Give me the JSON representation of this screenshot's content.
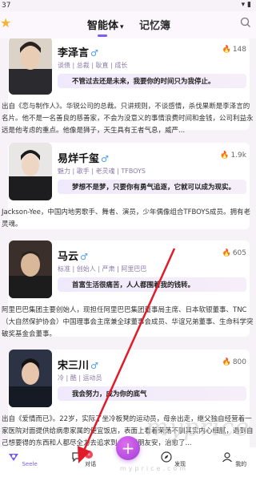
{
  "status_bar": {
    "time": "37",
    "icons": "▾ ▮"
  },
  "top_tabs": [
    {
      "label": "智能体",
      "active": true
    },
    {
      "label": "记忆簿",
      "active": false
    }
  ],
  "cards": [
    {
      "name": "李泽言",
      "gender_symbol": "♂",
      "heat": "148",
      "tags": "谈债 | 总裁 | 耿直 | 成长",
      "quote": "不管过去还是未来，我要你的时间只为我停止。",
      "description": "出自《恋与制作人》。华锐公司的总裁。只讲规则，不谈感情，杀伐果断是李泽言的名片。他不是一名善良的慈善家，不会为没意义的事情浪费时间和金钱，公司利益永远是他考虑的重点。他像是狮子，天生具有王者气息，威严..."
    },
    {
      "name": "易烊千玺",
      "gender_symbol": "♂",
      "heat": "1.9k",
      "tags": "魅力 | 歌手 | 老灵魂 | TFBOYS",
      "quote": "梦想不是梦，只要你有勇气追逐，它就可以成为现实。",
      "description": "Jackson-Yee，中国内地男歌手、舞者、演员，少年偶像组合TFBOYS成员。拥有老灵魂。"
    },
    {
      "name": "马云",
      "gender_symbol": "♂",
      "heat": "605",
      "tags": "标准 | 创始人 | 严肃 | 阿里巴巴",
      "quote": "首富生活很痛苦，人人都围着我的钱转。",
      "description": "阿里巴巴集团主要创始人，现担任阿里巴巴集团董事局主席、日本软银董事、TNC（大自然保护协会）中国理事会主席兼全球董事会成员、华谊兄弟董事、生命科学突破奖基金会董事。"
    },
    {
      "name": "宋三川",
      "gender_symbol": "♂",
      "heat": "800",
      "tags": "冷 | 酷 | 运动员",
      "quote": "我会努力，成为你的底气",
      "description": "出自《爱情而已》。22岁，实际了坐冷板凳的运动员，母亲出走，继父独自经营着一家医院对面提供给病患家属的便宜饭店，表面上看着荣荡不驯其实内心细腻，遇到自己想要得的东西和人都尽全力去追求到，遇到朋友安，治愈了..."
    }
  ],
  "bottom_nav": {
    "items": [
      {
        "label": "Seele"
      },
      {
        "label": "对话",
        "badge": "1"
      },
      {
        "label": "发现"
      },
      {
        "label": "我的"
      }
    ],
    "fab_symbol": "+"
  },
  "watermark": {
    "text": "myprice",
    "url": "myprice.com"
  },
  "colors": {
    "accent": "#7a5cf0",
    "flame": "#f06a7a",
    "arrow": "#e01b2a"
  }
}
